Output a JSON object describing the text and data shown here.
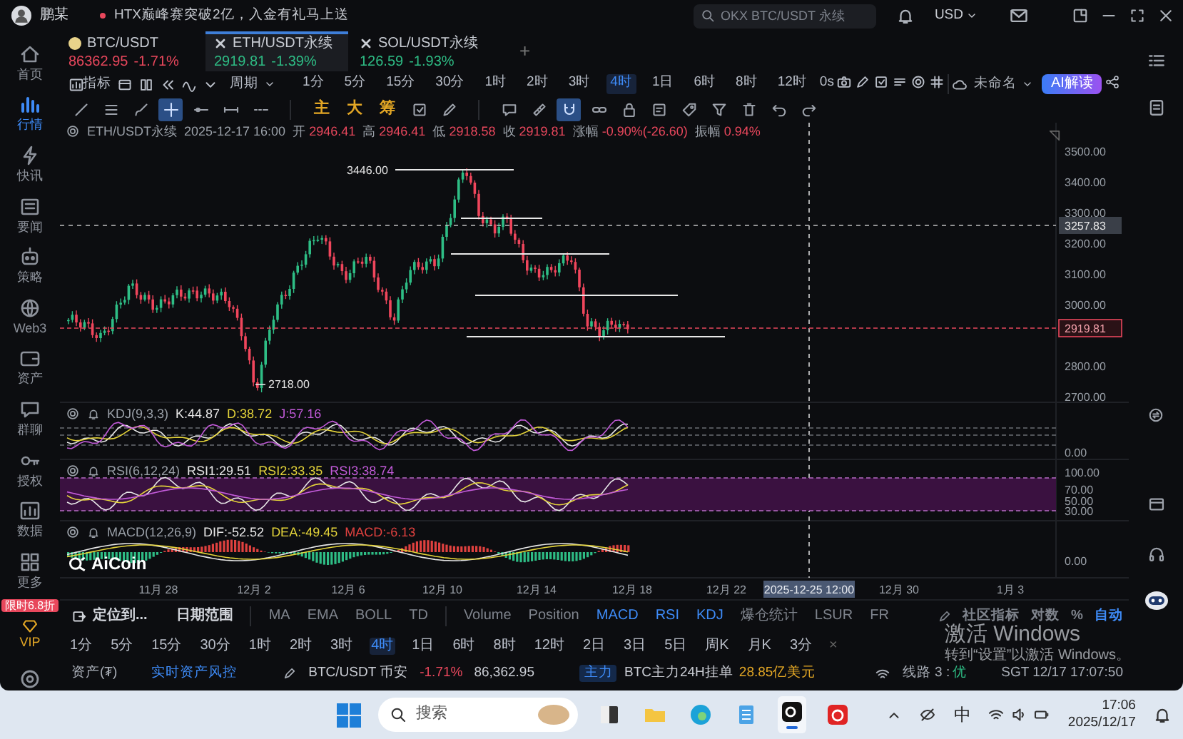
{
  "top_bar": {
    "user": "鹏某",
    "news": "HTX巅峰赛突破2亿，入金有礼马上送",
    "search": {
      "placeholder": "OKX BTC/USDT 永续"
    },
    "currency": "USD"
  },
  "sidebar": {
    "items": [
      {
        "label": "首页",
        "selected": false
      },
      {
        "label": "行情",
        "selected": true
      },
      {
        "label": "快讯",
        "selected": false
      },
      {
        "label": "要闻",
        "selected": false
      },
      {
        "label": "策略",
        "selected": false
      },
      {
        "label": "Web3",
        "selected": false
      },
      {
        "label": "资产",
        "selected": false
      },
      {
        "label": "群聊",
        "selected": false
      },
      {
        "label": "授权",
        "selected": false
      },
      {
        "label": "数据",
        "selected": false
      },
      {
        "label": "更多",
        "selected": false
      }
    ],
    "promo": "限时6.8折",
    "vip": "VIP"
  },
  "tabs": [
    {
      "kind": "spot",
      "symbol": "BTC/USDT",
      "price": "86362.95",
      "change": "-1.71%",
      "color": "#e8475c",
      "selected": false
    },
    {
      "kind": "perpetual",
      "symbol": "ETH/USDT永续",
      "price": "2919.81",
      "change": "-1.39%",
      "color": "#2ebd85",
      "selected": true
    },
    {
      "kind": "perpetual",
      "symbol": "SOL/USDT永续",
      "price": "126.59",
      "change": "-1.93%",
      "color": "#2ebd85",
      "selected": false
    }
  ],
  "add_tab": "+",
  "toolbar": {
    "indicator": "指标",
    "period": "周期",
    "periods": [
      {
        "label": "1分",
        "selected": false
      },
      {
        "label": "5分",
        "selected": false
      },
      {
        "label": "15分",
        "selected": false
      },
      {
        "label": "30分",
        "selected": false
      },
      {
        "label": "1时",
        "selected": false
      },
      {
        "label": "2时",
        "selected": false
      },
      {
        "label": "3时",
        "selected": false
      },
      {
        "label": "4时",
        "selected": true
      },
      {
        "label": "1日",
        "selected": false
      },
      {
        "label": "6时",
        "selected": false
      },
      {
        "label": "8时",
        "selected": false
      },
      {
        "label": "12时",
        "selected": false
      }
    ],
    "countdown": "0s",
    "layout": "未命名",
    "ai_button": "AI解读"
  },
  "draw_toolbar": {
    "tools": [
      {
        "selected": false
      },
      {
        "selected": false
      },
      {
        "selected": false
      },
      {
        "selected": true
      },
      {
        "selected": false
      },
      {
        "selected": false
      },
      {
        "selected": false
      },
      {
        "selected": false
      },
      {
        "selected": false
      },
      {
        "selected": false
      },
      {
        "selected": false
      },
      {
        "selected": true
      },
      {
        "selected": false
      },
      {
        "selected": false
      },
      {
        "selected": false
      },
      {
        "selected": false
      },
      {
        "selected": false
      },
      {
        "selected": false
      },
      {
        "selected": false
      },
      {
        "selected": false
      }
    ],
    "chips": [
      "主",
      "大",
      "筹"
    ]
  },
  "chart": {
    "legend": {
      "symbol": "ETH/USDT永续",
      "time": "2025-12-17 16:00",
      "fields": [
        {
          "label": "开",
          "value": "2946.41"
        },
        {
          "label": "高",
          "value": "2946.41"
        },
        {
          "label": "低",
          "value": "2918.58"
        },
        {
          "label": "收",
          "value": "2919.81"
        },
        {
          "label": "涨幅",
          "value": "-0.90%(-26.60)"
        },
        {
          "label": "振幅",
          "value": "0.94%"
        }
      ]
    },
    "y_ticks": [
      "3500.00",
      "3400.00",
      "3300.00",
      "3200.00",
      "3100.00",
      "3000.00",
      "2800.00",
      "2700.00"
    ],
    "crosshair_price": "3257.83",
    "last_price": "2919.81",
    "high_label": "3446.00",
    "low_label": "2718.00",
    "indicators": [
      {
        "name": "KDJ(9,3,3)",
        "values": [
          {
            "text": "K:44.87",
            "color": "#e6e6e6"
          },
          {
            "text": "D:38.72",
            "color": "#e3d33a"
          },
          {
            "text": "J:57.16",
            "color": "#c15ad8"
          }
        ],
        "axis": [
          "0.00"
        ]
      },
      {
        "name": "RSI(6,12,24)",
        "values": [
          {
            "text": "RSI1:29.51",
            "color": "#e6e6e6"
          },
          {
            "text": "RSI2:33.35",
            "color": "#e3d33a"
          },
          {
            "text": "RSI3:38.74",
            "color": "#c15ad8"
          }
        ],
        "axis": [
          "100.00",
          "70.00",
          "50.00",
          "30.00"
        ]
      },
      {
        "name": "MACD(12,26,9)",
        "values": [
          {
            "text": "DIF:-52.52",
            "color": "#e6e6e6"
          },
          {
            "text": "DEA:-49.45",
            "color": "#e3d33a"
          },
          {
            "text": "MACD:-6.13",
            "color": "#e0413f"
          }
        ],
        "axis": [
          "0.00"
        ]
      }
    ],
    "logo": "AiCoin",
    "x_labels": [
      "11月 28",
      "12月 2",
      "12月 6",
      "12月 10",
      "12月 14",
      "12月 18",
      "12月 22",
      "12月 30",
      "1月 3"
    ],
    "crosshair_time": "2025-12-25 12:00"
  },
  "indicator_bar": {
    "locate": "定位到...",
    "date_range": "日期范围",
    "main_indicators": [
      {
        "label": "MA",
        "selected": false
      },
      {
        "label": "EMA",
        "selected": false
      },
      {
        "label": "BOLL",
        "selected": false
      },
      {
        "label": "TD",
        "selected": false
      }
    ],
    "sub_indicators": [
      {
        "label": "Volume",
        "selected": false
      },
      {
        "label": "Position",
        "selected": false
      },
      {
        "label": "MACD",
        "selected": true
      },
      {
        "label": "RSI",
        "selected": true
      },
      {
        "label": "KDJ",
        "selected": true
      },
      {
        "label": "爆仓统计",
        "selected": false
      },
      {
        "label": "LSUR",
        "selected": false
      },
      {
        "label": "FR",
        "selected": false
      }
    ],
    "options": [
      {
        "label": "社区指标",
        "selected": false
      },
      {
        "label": "对数",
        "selected": false
      },
      {
        "label": "%",
        "selected": false
      },
      {
        "label": "自动",
        "selected": true
      }
    ]
  },
  "period_bar": {
    "periods": [
      {
        "label": "1分",
        "selected": false
      },
      {
        "label": "5分",
        "selected": false
      },
      {
        "label": "15分",
        "selected": false
      },
      {
        "label": "30分",
        "selected": false
      },
      {
        "label": "1时",
        "selected": false
      },
      {
        "label": "2时",
        "selected": false
      },
      {
        "label": "3时",
        "selected": false
      },
      {
        "label": "4时",
        "selected": true
      },
      {
        "label": "1日",
        "selected": false
      },
      {
        "label": "6时",
        "selected": false
      },
      {
        "label": "8时",
        "selected": false
      },
      {
        "label": "12时",
        "selected": false
      },
      {
        "label": "2日",
        "selected": false
      },
      {
        "label": "3日",
        "selected": false
      },
      {
        "label": "5日",
        "selected": false
      },
      {
        "label": "周K",
        "selected": false
      },
      {
        "label": "月K",
        "selected": false
      },
      {
        "label": "3分",
        "selected": false
      }
    ],
    "close": "×"
  },
  "status_bar": {
    "assets": "资产(₮)",
    "risk_link": "实时资产风控",
    "pair": "BTC/USDT 币安",
    "change": "-1.71%",
    "price": "86,362.95",
    "tag": "主力",
    "headline": "BTC主力24H挂单",
    "amount": "28.85亿美元",
    "line": "线路 3 :",
    "line_quality": "优",
    "clock": "SGT 12/17 17:07:50"
  },
  "windows_notice": {
    "title": "激活 Windows",
    "text": "转到“设置”以激活 Windows。"
  },
  "taskbar": {
    "search": {
      "placeholder": "搜索"
    },
    "apps": [
      {
        "selected": false
      },
      {
        "selected": false
      },
      {
        "selected": false
      },
      {
        "selected": false
      },
      {
        "selected": true
      },
      {
        "selected": false
      }
    ],
    "ime": "中",
    "time": "17:06",
    "date": "2025/12/17"
  }
}
